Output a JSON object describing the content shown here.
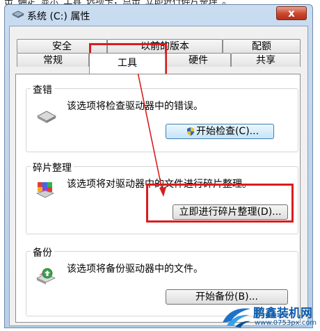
{
  "window": {
    "title": "系统 (C:) 属性",
    "close_label": "x"
  },
  "background_text": "击“确定”显示“工具”选项卡，点击“立即进行碎片整理”。",
  "tabs_top": [
    {
      "label": "安全"
    },
    {
      "label": "以前的版本"
    },
    {
      "label": "配额"
    }
  ],
  "tabs_bottom": [
    {
      "label": "常规"
    },
    {
      "label": "工具"
    },
    {
      "label": "硬件"
    },
    {
      "label": "共享"
    }
  ],
  "sections": {
    "error_check": {
      "title": "查错",
      "description": "该选项将检查驱动器中的错误。",
      "button": "开始检查(C)..."
    },
    "defrag": {
      "title": "碎片整理",
      "description": "该选项将对驱动器中的文件进行碎片整理。",
      "button": "立即进行碎片整理(D)..."
    },
    "backup": {
      "title": "备份",
      "description": "该选项将备份驱动器中的文件。",
      "button": "开始备份(B)..."
    }
  },
  "watermark": {
    "name": "鹏鑫装机网",
    "url": "www.0753px.com"
  },
  "colors": {
    "highlight": "#d81d1d",
    "watermark": "#0b5aa8"
  }
}
